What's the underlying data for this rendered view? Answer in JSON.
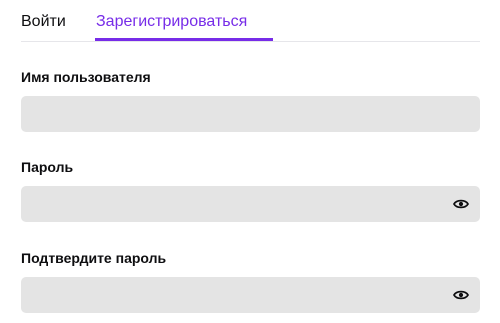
{
  "tabs": {
    "login_label": "Войти",
    "register_label": "Зарегистрироваться",
    "active": "register"
  },
  "form": {
    "username": {
      "label": "Имя пользователя",
      "value": "",
      "placeholder": ""
    },
    "password": {
      "label": "Пароль",
      "value": "",
      "placeholder": "",
      "toggle_icon": "eye-icon"
    },
    "confirm_password": {
      "label": "Подтвердите пароль",
      "value": "",
      "placeholder": "",
      "toggle_icon": "eye-icon"
    }
  },
  "colors": {
    "accent": "#772ce8",
    "input_background": "#e4e4e4",
    "text": "#0e0e10",
    "divider": "#e6e6ea"
  }
}
